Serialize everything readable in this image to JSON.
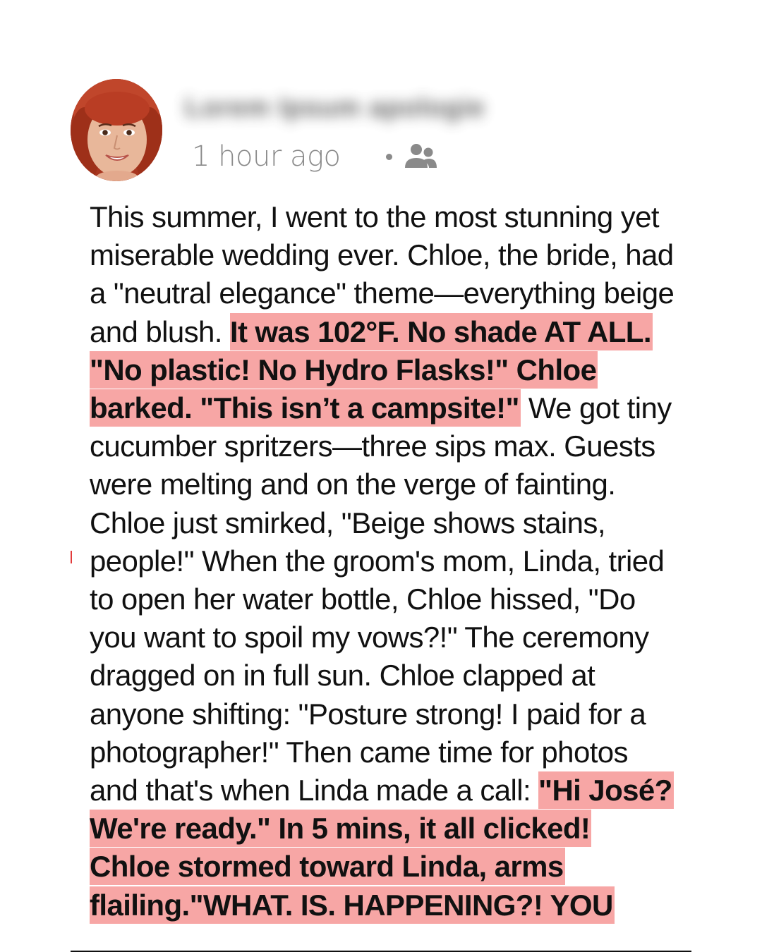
{
  "post": {
    "author_name": "Lorem Ipsum apologie",
    "timestamp": "1 hour ago",
    "audience_icon": "friends-icon",
    "body": {
      "seg1": "This summer, I went to the most stunning yet miserable wedding ever. Chloe, the bride, had a \"neutral elegance\" theme—everything beige and blush. ",
      "seg2": "It was 102°F. No shade AT ALL. \"No plastic! No Hydro Flasks!\" Chloe barked. \"This isn’t a campsite!\"",
      "seg3": " We got tiny cucumber spritzers—three sips max. Guests were melting and on the verge of fainting. Chloe just smirked, \"Beige shows stains, people!\" When the groom's mom, Linda, tried to open her water bottle, Chloe hissed, \"Do you want to spoil my vows?!\" The ceremony dragged on in full sun. Chloe clapped at anyone shifting: \"Posture strong! I paid for a photographer!\" Then came time for photos and that's when Linda made a call: ",
      "seg4": " \"Hi José? We're ready.\" In 5 mins, it all clicked! Chloe stormed toward Linda, arms flailing.\"WHAT. IS. HAPPENING?! YOU"
    }
  },
  "colors": {
    "highlight": "#f7a6a5",
    "text": "#111111",
    "meta": "#8a8a8a",
    "avatar_hair": "#b5402a"
  }
}
